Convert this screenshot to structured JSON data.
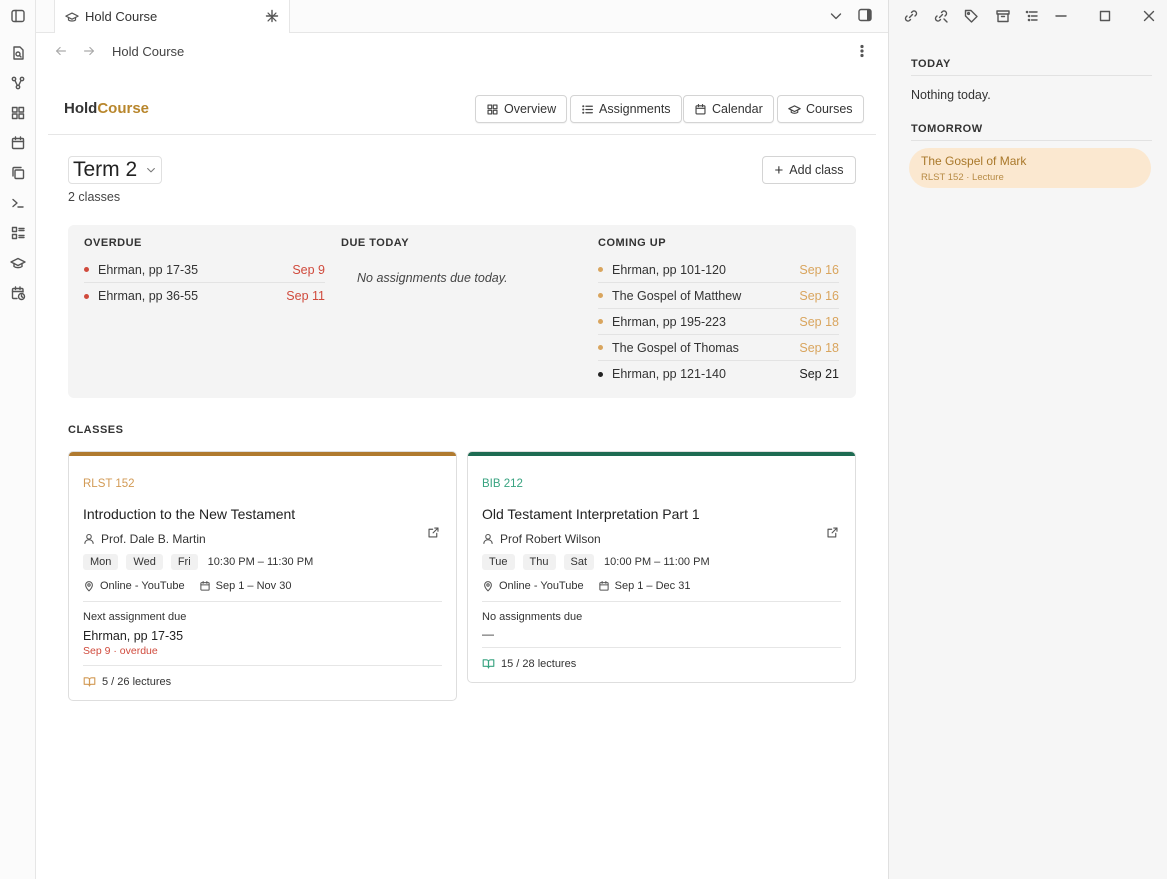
{
  "colors": {
    "accent": "#b8862c",
    "overdue": "#d04a3c",
    "upcoming": "#d9a55e",
    "course1_bar": "#b07a2f",
    "course2_bar": "#1e6b52",
    "course1_code": "#d29a55",
    "course2_code": "#38a380"
  },
  "tab": {
    "title": "Hold Course",
    "icon": "graduation-cap-icon"
  },
  "nav": {
    "title": "Hold Course"
  },
  "header": {
    "logo_a": "Hold",
    "logo_b": "Course",
    "buttons": [
      {
        "label": "Overview",
        "icon": "grid-icon"
      },
      {
        "label": "Assignments",
        "icon": "list-icon"
      },
      {
        "label": "Calendar",
        "icon": "calendar-icon"
      },
      {
        "label": "Courses",
        "icon": "graduation-cap-icon"
      }
    ]
  },
  "term": {
    "name": "Term 2",
    "count": "2 classes"
  },
  "add_class": "Add class",
  "summary": {
    "overdue": {
      "title": "OVERDUE",
      "items": [
        {
          "label": "Ehrman, pp 17-35",
          "date": "Sep 9"
        },
        {
          "label": "Ehrman, pp 36-55",
          "date": "Sep 11"
        }
      ]
    },
    "due_today": {
      "title": "DUE TODAY",
      "empty": "No assignments due today."
    },
    "coming_up": {
      "title": "COMING UP",
      "items": [
        {
          "label": "Ehrman, pp 101-120",
          "date": "Sep 16"
        },
        {
          "label": "The Gospel of Matthew",
          "date": "Sep 16"
        },
        {
          "label": "Ehrman, pp 195-223",
          "date": "Sep 18"
        },
        {
          "label": "The Gospel of Thomas",
          "date": "Sep 18"
        },
        {
          "label": "Ehrman, pp 121-140",
          "date": "Sep 21"
        }
      ]
    }
  },
  "classes_label": "CLASSES",
  "classes": [
    {
      "code": "RLST 152",
      "name": "Introduction to the New Testament",
      "prof": "Prof. Dale B. Martin",
      "days": [
        "Mon",
        "Wed",
        "Fri"
      ],
      "time": "10:30 PM – 11:30 PM",
      "location": "Online - YouTube",
      "range": "Sep 1 – Nov 30",
      "next_label": "Next assignment due",
      "next_title": "Ehrman, pp 17-35",
      "next_sub": "Sep 9 · overdue",
      "lectures": "5 / 26 lectures"
    },
    {
      "code": "BIB 212",
      "name": "Old Testament Interpretation Part 1",
      "prof": "Prof Robert Wilson",
      "days": [
        "Tue",
        "Thu",
        "Sat"
      ],
      "time": "10:00 PM – 11:00 PM",
      "location": "Online - YouTube",
      "range": "Sep 1 – Dec 31",
      "next_label": "No assignments due",
      "next_title": "—",
      "lectures": "15 / 28 lectures"
    }
  ],
  "sidebar": {
    "today_label": "TODAY",
    "today_text": "Nothing today.",
    "tomorrow_label": "TOMORROW",
    "event_title": "The Gospel of Mark",
    "event_sub": "RLST 152 · Lecture"
  }
}
